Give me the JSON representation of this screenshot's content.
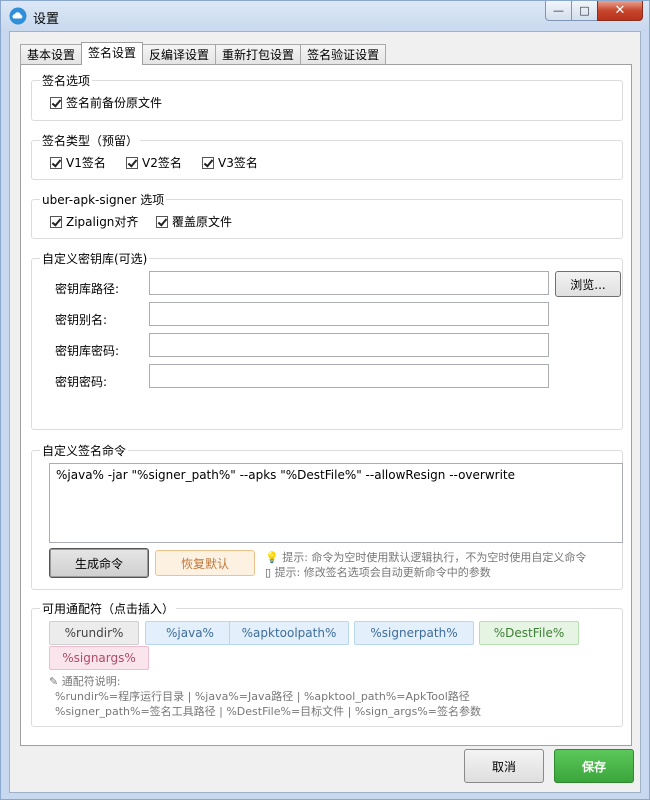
{
  "window": {
    "title": "设置",
    "icon": "cloud-app-icon",
    "controls": {
      "minimize": "—",
      "maximize": "□",
      "close": "✕"
    }
  },
  "tabs": [
    {
      "label": "基本设置",
      "active": false
    },
    {
      "label": "签名设置",
      "active": true
    },
    {
      "label": "反编译设置",
      "active": false
    },
    {
      "label": "重新打包设置",
      "active": false
    },
    {
      "label": "签名验证设置",
      "active": false
    }
  ],
  "sign_options": {
    "title": "签名选项",
    "backup": {
      "label": "签名前备份原文件",
      "checked": true
    }
  },
  "sign_type": {
    "title": "签名类型（预留）",
    "v1": {
      "label": "V1签名",
      "checked": true
    },
    "v2": {
      "label": "V2签名",
      "checked": true
    },
    "v3": {
      "label": "V3签名",
      "checked": true
    }
  },
  "uber": {
    "title": "uber-apk-signer 选项",
    "zipalign": {
      "label": "Zipalign对齐",
      "checked": true
    },
    "overwrite": {
      "label": "覆盖原文件",
      "checked": true
    }
  },
  "keystore": {
    "title": "自定义密钥库(可选)",
    "path_label": "密钥库路径:",
    "path_value": "",
    "alias_label": "密钥别名:",
    "alias_value": "",
    "store_password_label": "密钥库密码:",
    "store_password_value": "",
    "key_password_label": "密钥密码:",
    "key_password_value": "",
    "browse_label": "浏览..."
  },
  "custom_command": {
    "title": "自定义签名命令",
    "value": "%java% -jar \"%signer_path%\" --apks \"%DestFile%\" --allowResign --overwrite",
    "generate_label": "生成命令",
    "reset_label": "恢复默认",
    "hint1": "提示: 命令为空时使用默认逻辑执行，不为空时使用自定义命令",
    "hint2": "提示: 修改签名选项会自动更新命令中的参数"
  },
  "wildcards": {
    "title": "可用通配符（点击插入）",
    "chips": [
      {
        "label": "%rundir%",
        "color": "gray"
      },
      {
        "label": "%java%",
        "color": "blue"
      },
      {
        "label": "%apktoolpath%",
        "color": "blue"
      },
      {
        "label": "%signerpath%",
        "color": "blue"
      },
      {
        "label": "%DestFile%",
        "color": "green"
      },
      {
        "label": "%signargs%",
        "color": "pink"
      }
    ],
    "desc_title": "通配符说明:",
    "desc_line1": "%rundir%=程序运行目录 | %java%=Java路径 | %apktool_path%=ApkTool路径",
    "desc_line2": "%signer_path%=签名工具路径 | %DestFile%=目标文件 | %sign_args%=签名参数"
  },
  "footer": {
    "cancel_label": "取消",
    "save_label": "保存",
    "save_color": "#3aa53a"
  }
}
